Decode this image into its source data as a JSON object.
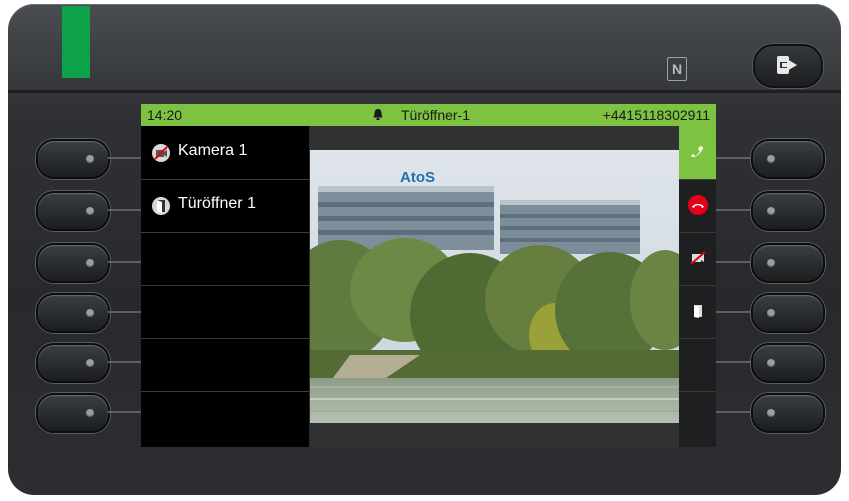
{
  "status_bar": {
    "time": "14:20",
    "call_name": "Türöffner-1",
    "phone_number": "+4415118302911"
  },
  "call_list": [
    {
      "label": "Kamera 1",
      "icon": "camera-off-icon"
    },
    {
      "label": "Türöffner 1",
      "icon": "door-icon"
    }
  ],
  "video": {
    "logo_text": "AtoS"
  },
  "softkeys": [
    {
      "icon": "answer-call-icon",
      "active": true
    },
    {
      "icon": "end-call-icon",
      "active": false
    },
    {
      "icon": "camera-off-icon",
      "active": false
    },
    {
      "icon": "door-icon",
      "active": false
    }
  ],
  "colors": {
    "accent_green": "#7dc241",
    "led_green": "#0ea24a",
    "end_call_red": "#e3001b",
    "screen_black": "#000000"
  }
}
